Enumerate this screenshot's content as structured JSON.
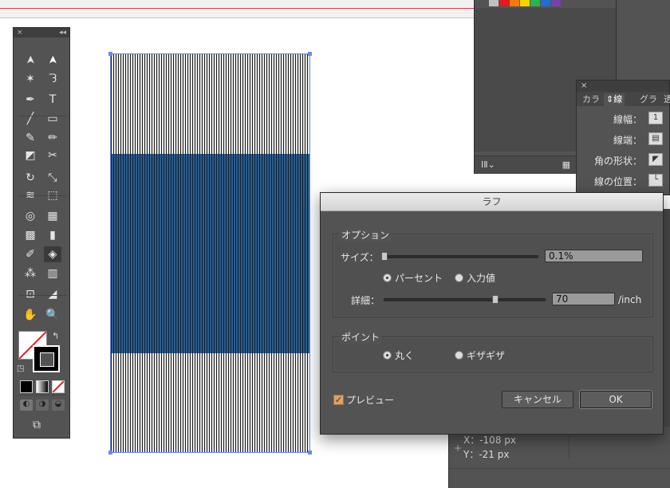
{
  "colors": {
    "accent_blue": "#6a8be6",
    "dialog_bg": "#535353",
    "band_blue": "#2c5c8a",
    "checkbox_orange": "#d9a070"
  },
  "toolbar": {
    "close": "×",
    "collapse": "◂◂",
    "tools": [
      {
        "name": "selection-tool-icon",
        "glyph": "➤"
      },
      {
        "name": "direct-selection-tool-icon",
        "glyph": "➤"
      },
      {
        "name": "magic-wand-tool-icon",
        "glyph": "✶"
      },
      {
        "name": "lasso-tool-icon",
        "glyph": "ᘊ"
      },
      {
        "name": "pen-tool-icon",
        "glyph": "✒"
      },
      {
        "name": "type-tool-icon",
        "glyph": "T"
      },
      {
        "name": "line-tool-icon",
        "glyph": "╱"
      },
      {
        "name": "rectangle-tool-icon",
        "glyph": "▭"
      },
      {
        "name": "paintbrush-tool-icon",
        "glyph": "✎"
      },
      {
        "name": "pencil-tool-icon",
        "glyph": "✏"
      },
      {
        "name": "eraser-tool-icon",
        "glyph": "◩"
      },
      {
        "name": "scissors-tool-icon",
        "glyph": "✂"
      },
      {
        "name": "rotate-tool-icon",
        "glyph": "↻"
      },
      {
        "name": "scale-tool-icon",
        "glyph": "⤡"
      },
      {
        "name": "width-tool-icon",
        "glyph": "≋"
      },
      {
        "name": "free-transform-tool-icon",
        "glyph": "⬚"
      },
      {
        "name": "shape-builder-tool-icon",
        "glyph": "◎"
      },
      {
        "name": "perspective-grid-tool-icon",
        "glyph": "▦"
      },
      {
        "name": "mesh-tool-icon",
        "glyph": "▩"
      },
      {
        "name": "gradient-tool-icon",
        "glyph": "▮"
      },
      {
        "name": "eyedropper-tool-icon",
        "glyph": "✐"
      },
      {
        "name": "blend-tool-icon",
        "glyph": "◈"
      },
      {
        "name": "symbol-sprayer-tool-icon",
        "glyph": "⁂"
      },
      {
        "name": "column-graph-tool-icon",
        "glyph": "▥"
      },
      {
        "name": "artboard-tool-icon",
        "glyph": "⊡"
      },
      {
        "name": "slice-tool-icon",
        "glyph": "◢"
      },
      {
        "name": "hand-tool-icon",
        "glyph": "✋"
      },
      {
        "name": "zoom-tool-icon",
        "glyph": "🔍"
      }
    ]
  },
  "swatches": {
    "colors": [
      "#c0c0c0",
      "#e21a1a",
      "#f07a10",
      "#f4d400",
      "#2db34a",
      "#1e6fd1",
      "#7a3fa8"
    ],
    "footer_icon": "ⅠⅡ⌄"
  },
  "stroke_panel": {
    "close": "×",
    "tabs": [
      "カラ",
      "線",
      "グラ",
      "透"
    ],
    "rows": [
      {
        "label": "線幅：",
        "value": "1"
      },
      {
        "label": "線端：",
        "value": "▤"
      },
      {
        "label": "角の形状：",
        "value": "◤"
      },
      {
        "label": "線の位置：",
        "value": "└"
      }
    ]
  },
  "info_panel": {
    "x": "X：-108 px",
    "y": "Y：-21 px",
    "plus": "+"
  },
  "dialog": {
    "title": "ラフ",
    "options_title": "オプション",
    "size_label": "サイズ：",
    "size_value": "0.1%",
    "size_fraction": 0.0,
    "percent_label": "パーセント",
    "absolute_label": "入力値",
    "detail_label": "詳細：",
    "detail_value": "70",
    "detail_unit": "/inch",
    "points_title": "ポイント",
    "smooth_label": "丸く",
    "corner_label": "ギザギザ",
    "preview_label": "プレビュー",
    "preview_check": "✓",
    "cancel_label": "キャンセル",
    "ok_label": "OK"
  }
}
